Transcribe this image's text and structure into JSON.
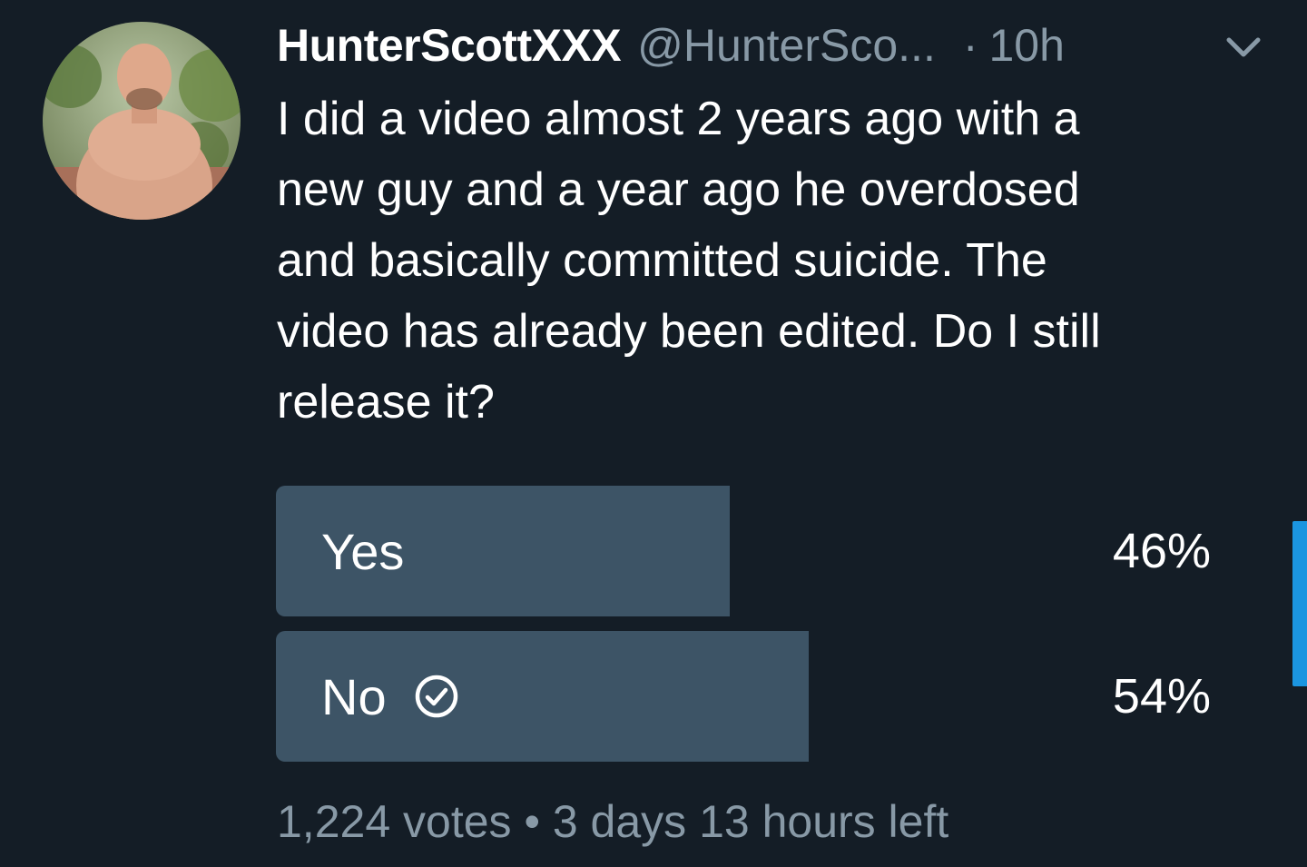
{
  "tweet": {
    "display_name": "HunterScottXXX",
    "handle": "@HunterSco...",
    "separator": "·",
    "time": "10h",
    "avatar_icon": "profile-photo",
    "caret_icon": "chevron-down-icon",
    "text": "I did a video  almost 2 years ago with a\nnew guy and a year ago he overdosed\nand basically committed suicide. The\nvideo has already been edited. Do I still\nrelease it?"
  },
  "poll": {
    "options": [
      {
        "label": "Yes",
        "percent_text": "46%",
        "fraction": 0.46,
        "winner": false
      },
      {
        "label": "No",
        "percent_text": "54%",
        "fraction": 0.54,
        "winner": true,
        "winner_icon": "check-circle-icon"
      }
    ],
    "votes": "1,224 votes",
    "meta_separator": "•",
    "time_left": "3 days 13 hours left"
  },
  "colors": {
    "background": "#141d26",
    "poll_fill": "#3d5466",
    "secondary_text": "#8899a6",
    "accent": "#1b95e0"
  }
}
